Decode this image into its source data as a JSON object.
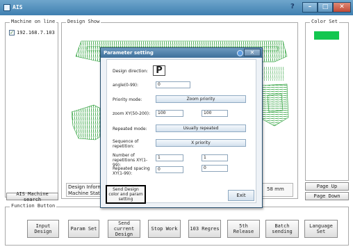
{
  "window": {
    "title": "AIS",
    "help": "?",
    "minimize": "–",
    "maximize": "□",
    "close": "✕"
  },
  "machine_list": {
    "title": "Machine on line",
    "items": [
      {
        "label": "192.168.7.103",
        "checked": true
      }
    ],
    "search_button": "AIS Machine search"
  },
  "design_view": {
    "title": "Design Show",
    "info_label_1": "Design Information",
    "info_label_2": "Machine State:",
    "size_text": "58 mm"
  },
  "color_set": {
    "title": "Color Set",
    "swatch_color": "#13c64f"
  },
  "paging": {
    "page_up": "Page Up",
    "page_down": "Page Down"
  },
  "function_button": {
    "title": "Function Button",
    "buttons": [
      "Input Design",
      "Param Set",
      "Send current Design",
      "Stop Work",
      "103 Regres",
      "5th Release",
      "Batch sending",
      "Language Set"
    ]
  },
  "dialog": {
    "title": "Parameter setting",
    "close": "✕",
    "design_direction_label": "Design direction:",
    "design_direction_value": "P",
    "angle_label": "angle(0-99):",
    "angle_value": "0",
    "priority_mode_label": "Priority mode:",
    "priority_mode_value": "Zoom priority",
    "zoom_label": "zoom XY(50-200):",
    "zoom_x": "100",
    "zoom_y": "100",
    "repeated_mode_label": "Repeated mode:",
    "repeated_mode_value": "Usually repeated",
    "sequence_label": "Sequence of repetition:",
    "sequence_value": "X priority",
    "number_label": "Number of repetitions XY(1-99):",
    "number_x": "1",
    "number_y": "1",
    "spacing_label": "Repeated spacing XY(1-99):",
    "spacing_x": "0",
    "spacing_y": "0",
    "send_button": "Send Design color and param setting",
    "exit_button": "Exit"
  }
}
